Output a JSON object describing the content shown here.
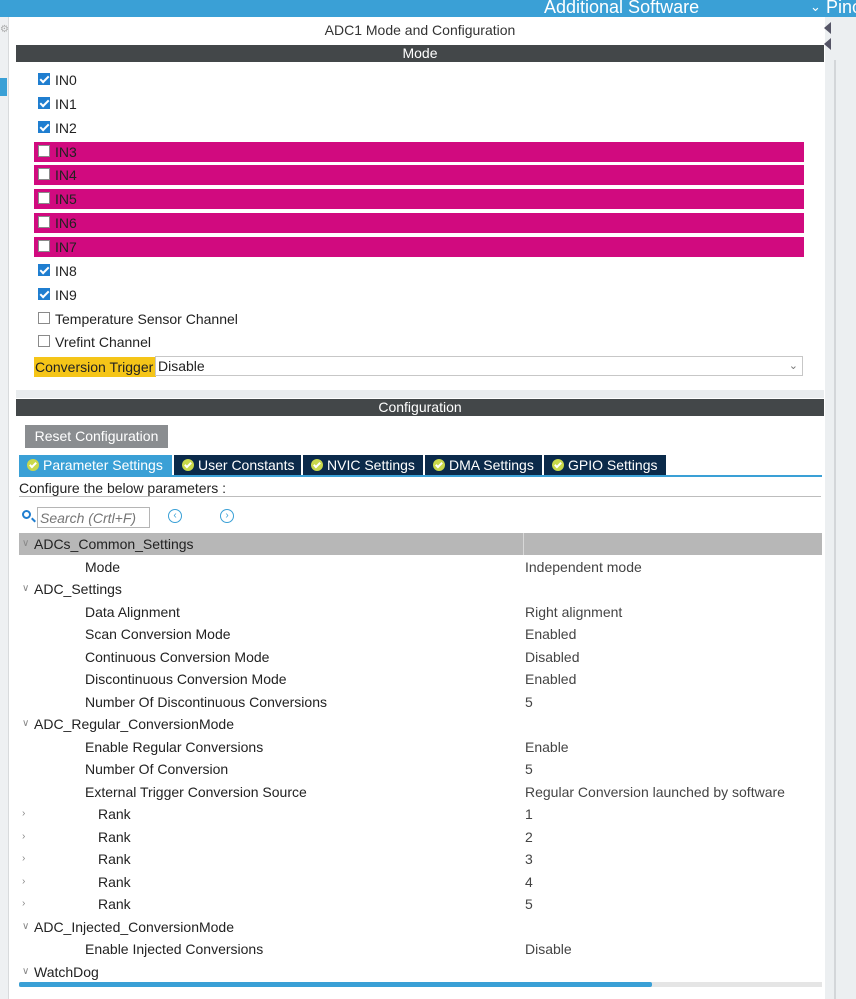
{
  "topbar": {
    "additional_software": "Additional Software",
    "pinout": "Pino"
  },
  "panel": {
    "title": "ADC1 Mode and Configuration",
    "mode_header": "Mode",
    "config_header": "Configuration"
  },
  "channels": [
    {
      "label": "IN0",
      "checked": true,
      "highlight": false
    },
    {
      "label": "IN1",
      "checked": true,
      "highlight": false
    },
    {
      "label": "IN2",
      "checked": true,
      "highlight": false
    },
    {
      "label": "IN3",
      "checked": false,
      "highlight": true
    },
    {
      "label": "IN4",
      "checked": false,
      "highlight": true
    },
    {
      "label": "IN5",
      "checked": false,
      "highlight": true
    },
    {
      "label": "IN6",
      "checked": false,
      "highlight": true
    },
    {
      "label": "IN7",
      "checked": false,
      "highlight": true
    },
    {
      "label": "IN8",
      "checked": true,
      "highlight": false
    },
    {
      "label": "IN9",
      "checked": true,
      "highlight": false
    },
    {
      "label": "Temperature Sensor Channel",
      "checked": false,
      "highlight": false
    },
    {
      "label": "Vrefint Channel",
      "checked": false,
      "highlight": false
    }
  ],
  "conversion_trigger": {
    "label": "Conversion Trigger",
    "value": "Disable"
  },
  "config": {
    "reset_label": "Reset Configuration",
    "tabs": [
      "Parameter Settings",
      "User Constants",
      "NVIC Settings",
      "DMA Settings",
      "GPIO Settings"
    ],
    "configure_text": "Configure the below parameters :",
    "search_placeholder": "Search (Crtl+F)"
  },
  "tree": [
    {
      "kind": "group",
      "name": "ADCs_Common_Settings",
      "value": "",
      "selected": true
    },
    {
      "kind": "item",
      "name": "Mode",
      "value": "Independent mode"
    },
    {
      "kind": "group",
      "name": "ADC_Settings",
      "value": ""
    },
    {
      "kind": "item",
      "name": "Data Alignment",
      "value": "Right alignment"
    },
    {
      "kind": "item",
      "name": "Scan Conversion Mode",
      "value": "Enabled"
    },
    {
      "kind": "item",
      "name": "Continuous Conversion Mode",
      "value": "Disabled"
    },
    {
      "kind": "item",
      "name": "Discontinuous Conversion Mode",
      "value": "Enabled"
    },
    {
      "kind": "item",
      "name": "Number Of Discontinuous Conversions",
      "value": "5"
    },
    {
      "kind": "group",
      "name": "ADC_Regular_ConversionMode",
      "value": ""
    },
    {
      "kind": "item",
      "name": "Enable Regular Conversions",
      "value": "Enable"
    },
    {
      "kind": "item",
      "name": "Number Of Conversion",
      "value": "5"
    },
    {
      "kind": "item",
      "name": "External Trigger Conversion Source",
      "value": "Regular Conversion launched by software"
    },
    {
      "kind": "sub",
      "name": "Rank",
      "value": "1"
    },
    {
      "kind": "sub",
      "name": "Rank",
      "value": "2"
    },
    {
      "kind": "sub",
      "name": "Rank",
      "value": "3"
    },
    {
      "kind": "sub",
      "name": "Rank",
      "value": "4"
    },
    {
      "kind": "sub",
      "name": "Rank",
      "value": "5"
    },
    {
      "kind": "group",
      "name": "ADC_Injected_ConversionMode",
      "value": ""
    },
    {
      "kind": "item",
      "name": "Enable Injected Conversions",
      "value": "Disable"
    },
    {
      "kind": "group",
      "name": "WatchDog",
      "value": ""
    }
  ],
  "icons": {
    "check": "checkmark-icon",
    "tab_ok": "check-circle-icon",
    "search": "search-icon",
    "prev": "chevron-left-circle-icon",
    "next": "chevron-right-circle-icon",
    "expand": "chevron-down-icon",
    "collapsed": "chevron-right-icon"
  },
  "colors": {
    "accent": "#3aa0d6",
    "tab_dark": "#0b2a4a",
    "conflict": "#d10a7f",
    "trigger_highlight": "#f5c518",
    "header_dark": "#434749"
  }
}
